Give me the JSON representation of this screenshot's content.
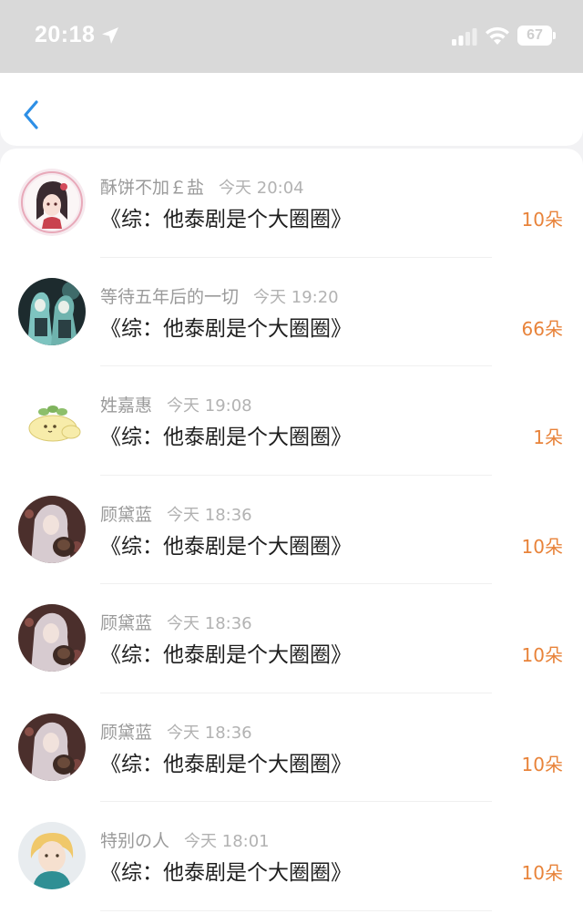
{
  "status": {
    "time": "20:18",
    "battery": "67"
  },
  "nav": {
    "back_icon": "chevron-left-icon"
  },
  "records": [
    {
      "name": "酥饼不加￡盐",
      "time": "今天 20:04",
      "title": "《综：他泰剧是个大圈圈》",
      "amount": "10朵",
      "avatar": "anime-girl-pink-border"
    },
    {
      "name": "等待五年后的一切",
      "time": "今天 19:20",
      "title": "《综：他泰剧是个大圈圈》",
      "amount": "66朵",
      "avatar": "twin-anime-girls-teal"
    },
    {
      "name": "姓嘉惠",
      "time": "今天 19:08",
      "title": "《综：他泰剧是个大圈圈》",
      "amount": "1朵",
      "avatar": "yellow-blob-with-leaves"
    },
    {
      "name": "顾黛蓝",
      "time": "今天 18:36",
      "title": "《综：他泰剧是个大圈圈》",
      "amount": "10朵",
      "avatar": "silver-hair-girl-with-dog"
    },
    {
      "name": "顾黛蓝",
      "time": "今天 18:36",
      "title": "《综：他泰剧是个大圈圈》",
      "amount": "10朵",
      "avatar": "silver-hair-girl-with-dog"
    },
    {
      "name": "顾黛蓝",
      "time": "今天 18:36",
      "title": "《综：他泰剧是个大圈圈》",
      "amount": "10朵",
      "avatar": "silver-hair-girl-with-dog"
    },
    {
      "name": "特别の人",
      "time": "今天 18:01",
      "title": "《综：他泰剧是个大圈圈》",
      "amount": "10朵",
      "avatar": "blonde-boy-teal-sweater"
    }
  ],
  "colors": {
    "amount": "#e8833a",
    "back": "#2d8fe6",
    "status_bar": "#d9d9d9"
  }
}
